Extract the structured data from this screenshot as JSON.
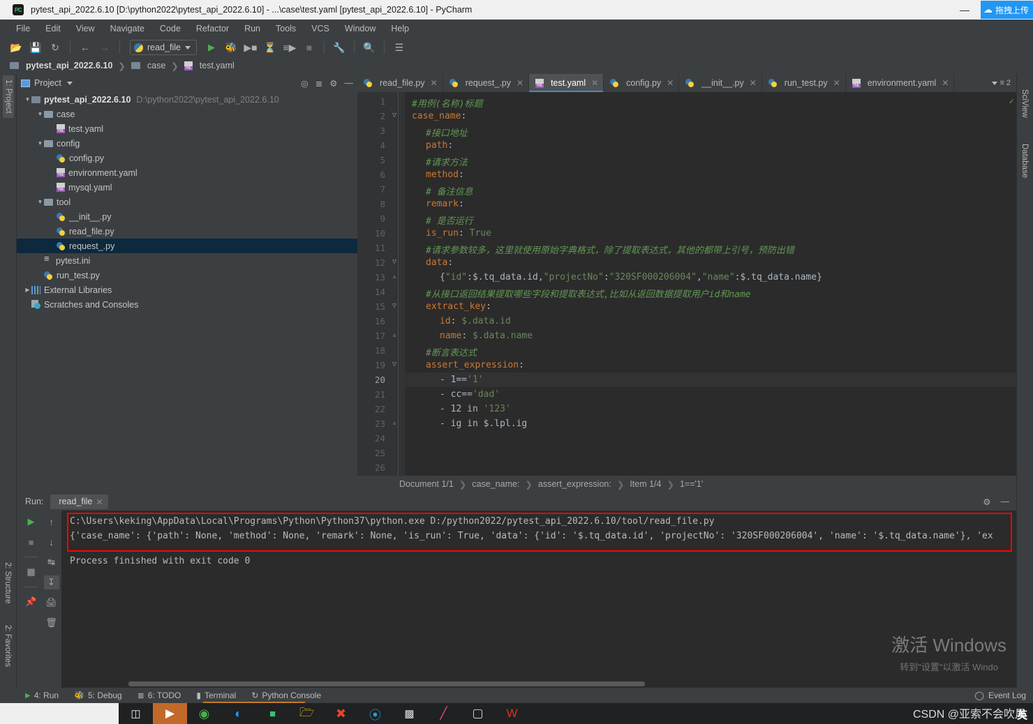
{
  "titlebar": {
    "title": "pytest_api_2022.6.10 [D:\\python2022\\pytest_api_2022.6.10] - ...\\case\\test.yaml [pytest_api_2022.6.10] - PyCharm",
    "logo": "PC",
    "minimize": "—",
    "upload_badge": "拖拽上传"
  },
  "menu": [
    "File",
    "Edit",
    "View",
    "Navigate",
    "Code",
    "Refactor",
    "Run",
    "Tools",
    "VCS",
    "Window",
    "Help"
  ],
  "toolbar": {
    "run_config": "read_file",
    "icons": [
      "open-icon",
      "save-icon",
      "sync-icon",
      "back-icon",
      "forward-icon",
      "run-icon",
      "debug-icon",
      "coverage-icon",
      "profile-icon",
      "run-with-icon",
      "stop-icon",
      "settings-wrench-icon",
      "search-icon",
      "structure-icon"
    ]
  },
  "breadcrumb": {
    "project": "pytest_api_2022.6.10",
    "folder": "case",
    "file": "test.yaml"
  },
  "left_rail": [
    "1: Project",
    "2: Structure",
    "2: Favorites"
  ],
  "right_rail": [
    "SciView",
    "Database"
  ],
  "project_panel": {
    "title": "Project",
    "tree": [
      {
        "indent": 0,
        "arrow": "▼",
        "icon": "folder-icon",
        "label": "pytest_api_2022.6.10",
        "bold": true,
        "path": "D:\\python2022\\pytest_api_2022.6.10",
        "selected": false
      },
      {
        "indent": 1,
        "arrow": "▼",
        "icon": "folder-src-icon",
        "label": "case",
        "bold": false,
        "path": "",
        "selected": false
      },
      {
        "indent": 2,
        "arrow": "",
        "icon": "yaml-icon",
        "label": "test.yaml",
        "bold": false,
        "path": "",
        "selected": false
      },
      {
        "indent": 1,
        "arrow": "▼",
        "icon": "folder-src-icon",
        "label": "config",
        "bold": false,
        "path": "",
        "selected": false
      },
      {
        "indent": 2,
        "arrow": "",
        "icon": "python-icon",
        "label": "config.py",
        "bold": false,
        "path": "",
        "selected": false
      },
      {
        "indent": 2,
        "arrow": "",
        "icon": "yaml-icon",
        "label": "environment.yaml",
        "bold": false,
        "path": "",
        "selected": false
      },
      {
        "indent": 2,
        "arrow": "",
        "icon": "yaml-icon",
        "label": "mysql.yaml",
        "bold": false,
        "path": "",
        "selected": false
      },
      {
        "indent": 1,
        "arrow": "▼",
        "icon": "folder-src-icon",
        "label": "tool",
        "bold": false,
        "path": "",
        "selected": false
      },
      {
        "indent": 2,
        "arrow": "",
        "icon": "python-icon",
        "label": "__init__.py",
        "bold": false,
        "path": "",
        "selected": false
      },
      {
        "indent": 2,
        "arrow": "",
        "icon": "python-icon",
        "label": "read_file.py",
        "bold": false,
        "path": "",
        "selected": false
      },
      {
        "indent": 2,
        "arrow": "",
        "icon": "python-icon",
        "label": "request_.py",
        "bold": false,
        "path": "",
        "selected": true
      },
      {
        "indent": 1,
        "arrow": "",
        "icon": "ini-icon",
        "label": "pytest.ini",
        "bold": false,
        "path": "",
        "selected": false
      },
      {
        "indent": 1,
        "arrow": "",
        "icon": "python-icon",
        "label": "run_test.py",
        "bold": false,
        "path": "",
        "selected": false
      },
      {
        "indent": 0,
        "arrow": "▶",
        "icon": "library-icon",
        "label": "External Libraries",
        "bold": false,
        "path": "",
        "selected": false
      },
      {
        "indent": 0,
        "arrow": "",
        "icon": "scratches-icon",
        "label": "Scratches and Consoles",
        "bold": false,
        "path": "",
        "selected": false
      }
    ]
  },
  "editor": {
    "tabs": [
      {
        "label": "read_file.py",
        "icon": "python-icon",
        "active": false
      },
      {
        "label": "request_.py",
        "icon": "python-icon",
        "active": false
      },
      {
        "label": "test.yaml",
        "icon": "yaml-icon",
        "active": true
      },
      {
        "label": "config.py",
        "icon": "python-icon",
        "active": false
      },
      {
        "label": "__init__.py",
        "icon": "python-icon",
        "active": false
      },
      {
        "label": "run_test.py",
        "icon": "python-icon",
        "active": false
      },
      {
        "label": "environment.yaml",
        "icon": "yaml-icon",
        "active": false
      }
    ],
    "tab_overflow_count": "2",
    "current_line": 20,
    "lines": [
      {
        "n": 1,
        "fold": "",
        "segments": [
          {
            "t": "#用例(名称)标题",
            "c": "cmt"
          }
        ],
        "indent": 0
      },
      {
        "n": 2,
        "fold": "▽",
        "segments": [
          {
            "t": "case_name",
            "c": "key"
          },
          {
            "t": ":",
            "c": "val"
          }
        ],
        "indent": 0
      },
      {
        "n": 3,
        "fold": "",
        "segments": [
          {
            "t": "#接口地址",
            "c": "cmt"
          }
        ],
        "indent": 1
      },
      {
        "n": 4,
        "fold": "",
        "segments": [
          {
            "t": "path",
            "c": "key"
          },
          {
            "t": ":",
            "c": "val"
          }
        ],
        "indent": 1
      },
      {
        "n": 5,
        "fold": "",
        "segments": [
          {
            "t": "#请求方法",
            "c": "cmt"
          }
        ],
        "indent": 1
      },
      {
        "n": 6,
        "fold": "",
        "segments": [
          {
            "t": "method",
            "c": "key"
          },
          {
            "t": ":",
            "c": "val"
          }
        ],
        "indent": 1
      },
      {
        "n": 7,
        "fold": "",
        "segments": [
          {
            "t": "# 备注信息",
            "c": "cmt"
          }
        ],
        "indent": 1
      },
      {
        "n": 8,
        "fold": "",
        "segments": [
          {
            "t": "remark",
            "c": "key"
          },
          {
            "t": ":",
            "c": "val"
          }
        ],
        "indent": 1
      },
      {
        "n": 9,
        "fold": "",
        "segments": [
          {
            "t": "# 是否运行",
            "c": "cmt"
          }
        ],
        "indent": 1
      },
      {
        "n": 10,
        "fold": "",
        "segments": [
          {
            "t": "is_run",
            "c": "key"
          },
          {
            "t": ": ",
            "c": "val"
          },
          {
            "t": "True",
            "c": "str"
          }
        ],
        "indent": 1
      },
      {
        "n": 11,
        "fold": "",
        "segments": [
          {
            "t": "#请求参数较多，这里就使用原始字典格式，除了提取表达式，其他的都带上引号，预防出错",
            "c": "cmt"
          }
        ],
        "indent": 1
      },
      {
        "n": 12,
        "fold": "▽",
        "segments": [
          {
            "t": "data",
            "c": "key"
          },
          {
            "t": ":",
            "c": "val"
          }
        ],
        "indent": 1
      },
      {
        "n": 13,
        "fold": "▵",
        "segments": [
          {
            "t": "{",
            "c": "val"
          },
          {
            "t": "\"id\"",
            "c": "str"
          },
          {
            "t": ":$.tq_data.id,",
            "c": "val"
          },
          {
            "t": "\"projectNo\"",
            "c": "str"
          },
          {
            "t": ":",
            "c": "val"
          },
          {
            "t": "\"320SF000206004\"",
            "c": "str"
          },
          {
            "t": ",",
            "c": "val"
          },
          {
            "t": "\"name\"",
            "c": "str"
          },
          {
            "t": ":$.tq_data.name}",
            "c": "val"
          }
        ],
        "indent": 2
      },
      {
        "n": 14,
        "fold": "",
        "segments": [
          {
            "t": "#从接口返回结果提取哪些字段和提取表达式,比如从返回数据提取用户id和name",
            "c": "cmt"
          }
        ],
        "indent": 1
      },
      {
        "n": 15,
        "fold": "▽",
        "segments": [
          {
            "t": "extract_key",
            "c": "key"
          },
          {
            "t": ":",
            "c": "val"
          }
        ],
        "indent": 1
      },
      {
        "n": 16,
        "fold": "",
        "segments": [
          {
            "t": "id",
            "c": "key"
          },
          {
            "t": ": ",
            "c": "val"
          },
          {
            "t": "$.data.id",
            "c": "str"
          }
        ],
        "indent": 2
      },
      {
        "n": 17,
        "fold": "▵",
        "segments": [
          {
            "t": "name",
            "c": "key"
          },
          {
            "t": ": ",
            "c": "val"
          },
          {
            "t": "$.data.name",
            "c": "str"
          }
        ],
        "indent": 2
      },
      {
        "n": 18,
        "fold": "",
        "segments": [
          {
            "t": "#断言表达式",
            "c": "cmt"
          }
        ],
        "indent": 1
      },
      {
        "n": 19,
        "fold": "▽",
        "segments": [
          {
            "t": "assert_expression",
            "c": "key"
          },
          {
            "t": ":",
            "c": "val"
          }
        ],
        "indent": 1
      },
      {
        "n": 20,
        "fold": "",
        "segments": [
          {
            "t": "- 1==",
            "c": "val"
          },
          {
            "t": "'1'",
            "c": "str"
          }
        ],
        "indent": 2
      },
      {
        "n": 21,
        "fold": "",
        "segments": [
          {
            "t": "- cc==",
            "c": "val"
          },
          {
            "t": "'dad'",
            "c": "str"
          }
        ],
        "indent": 2
      },
      {
        "n": 22,
        "fold": "",
        "segments": [
          {
            "t": "- 12 in ",
            "c": "val"
          },
          {
            "t": "'123'",
            "c": "str"
          }
        ],
        "indent": 2
      },
      {
        "n": 23,
        "fold": "▵",
        "segments": [
          {
            "t": "- ig in $.lpl.ig",
            "c": "val"
          }
        ],
        "indent": 2
      },
      {
        "n": 24,
        "fold": "",
        "segments": [],
        "indent": 0
      },
      {
        "n": 25,
        "fold": "",
        "segments": [],
        "indent": 0
      },
      {
        "n": 26,
        "fold": "",
        "segments": [],
        "indent": 0
      }
    ],
    "status_breadcrumb": [
      "Document 1/1",
      "case_name:",
      "assert_expression:",
      "Item 1/4",
      "1=='1'"
    ]
  },
  "run_panel": {
    "label": "Run:",
    "tab": "read_file",
    "console_lines": [
      "C:\\Users\\keking\\AppData\\Local\\Programs\\Python\\Python37\\python.exe D:/python2022/pytest_api_2022.6.10/tool/read_file.py",
      "{'case_name': {'path': None, 'method': None, 'remark': None, 'is_run': True, 'data': {'id': '$.tq_data.id', 'projectNo': '320SF000206004', 'name': '$.tq_data.name'}, 'ex",
      "",
      "Process finished with exit code 0"
    ],
    "highlight_color": "#fe0000"
  },
  "watermark": {
    "line1": "激活 Windows",
    "line2": "转到\"设置\"以激活 Windo"
  },
  "statusbar": {
    "items": [
      "4: Run",
      "5: Debug",
      "6: TODO",
      "Terminal",
      "Python Console"
    ],
    "event_log": "Event Log"
  },
  "taskbar": {
    "icons": [
      "task-view-icon",
      "bilibili-icon",
      "chrome-icon",
      "edge-icon",
      "pycharm-icon",
      "explorer-icon",
      "xmind-icon",
      "navicat-icon",
      "cmd-icon",
      "pen-icon",
      "notes-icon",
      "wps-icon"
    ]
  },
  "csdn_watermark": "CSDN @亚索不会吹风",
  "ime_badge": "英"
}
